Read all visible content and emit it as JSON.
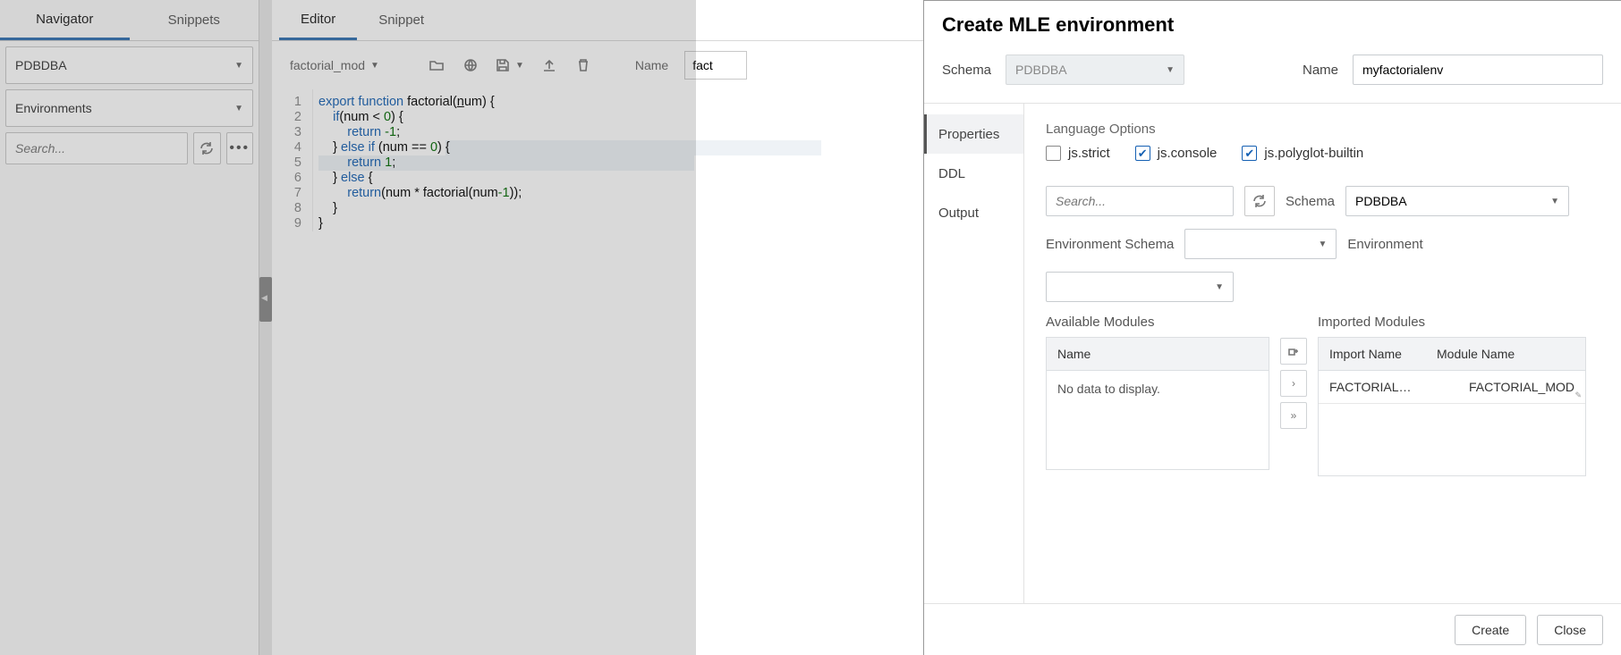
{
  "leftTabs": {
    "navigator": "Navigator",
    "snippets": "Snippets"
  },
  "leftSelects": {
    "schema": "PDBDBA",
    "group": "Environments"
  },
  "leftSearch": {
    "placeholder": "Search..."
  },
  "editorTabs": {
    "editor": "Editor",
    "snippet": "Snippet"
  },
  "toolbar": {
    "file": "factorial_mod",
    "nameLabel": "Name",
    "nameValue": "fact"
  },
  "code": {
    "lines": [
      "1",
      "2",
      "3",
      "4",
      "5",
      "6",
      "7",
      "8",
      "9"
    ],
    "text": [
      "export function factorial(num) {",
      "    if(num < 0) {",
      "        return -1;",
      "    } else if (num == 0) {",
      "        return 1;",
      "    } else {",
      "        return(num * factorial(num-1));",
      "    }",
      "}"
    ]
  },
  "dialog": {
    "title": "Create MLE environment",
    "schemaLabel": "Schema",
    "schemaValue": "PDBDBA",
    "nameLabel": "Name",
    "nameValue": "myfactorialenv",
    "tabs": {
      "properties": "Properties",
      "ddl": "DDL",
      "output": "Output"
    },
    "langOptionsLabel": "Language Options",
    "checks": {
      "strict": "js.strict",
      "console": "js.console",
      "polyglot": "js.polyglot-builtin"
    },
    "searchPlaceholder": "Search...",
    "schema2Label": "Schema",
    "schema2Value": "PDBDBA",
    "envSchemaLabel": "Environment Schema",
    "envLabel": "Environment",
    "availLabel": "Available Modules",
    "availCol": "Name",
    "availEmpty": "No data to display.",
    "impLabel": "Imported Modules",
    "impCol1": "Import Name",
    "impCol2": "Module Name",
    "impRow": {
      "importName": "FACTORIAL_M...",
      "moduleName": "FACTORIAL_MOD"
    },
    "footer": {
      "create": "Create",
      "close": "Close"
    }
  }
}
